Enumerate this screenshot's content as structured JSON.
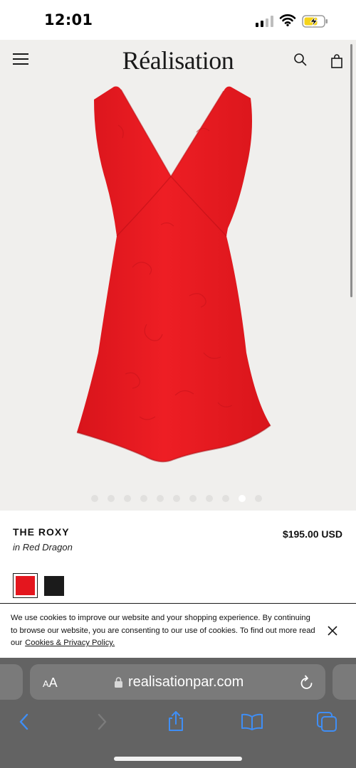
{
  "status_bar": {
    "time": "12:01"
  },
  "site_header": {
    "logo": "Réalisation"
  },
  "gallery": {
    "image_count": 11,
    "active_index": 9
  },
  "product": {
    "name": "THE ROXY",
    "variant": "in Red Dragon",
    "price": "$195.00 USD",
    "swatches": [
      {
        "name": "Red Dragon",
        "color": "#e4161e",
        "selected": true
      },
      {
        "name": "Black",
        "color": "#1b1b1b",
        "selected": false
      }
    ]
  },
  "cookie_banner": {
    "text": "We use cookies to improve our website and your shopping experience. By continuing to browse our website, you are consenting to our use of cookies. To find out more read our",
    "link_text": "Cookies & Privacy Policy."
  },
  "browser": {
    "text_size_label_small": "A",
    "text_size_label_large": "A",
    "url": "realisationpar.com"
  },
  "colors": {
    "dress_red": "#e4161e",
    "page_background": "#f0efed",
    "safari_toolbar": "#636363",
    "ios_blue": "#3f8ef5"
  }
}
